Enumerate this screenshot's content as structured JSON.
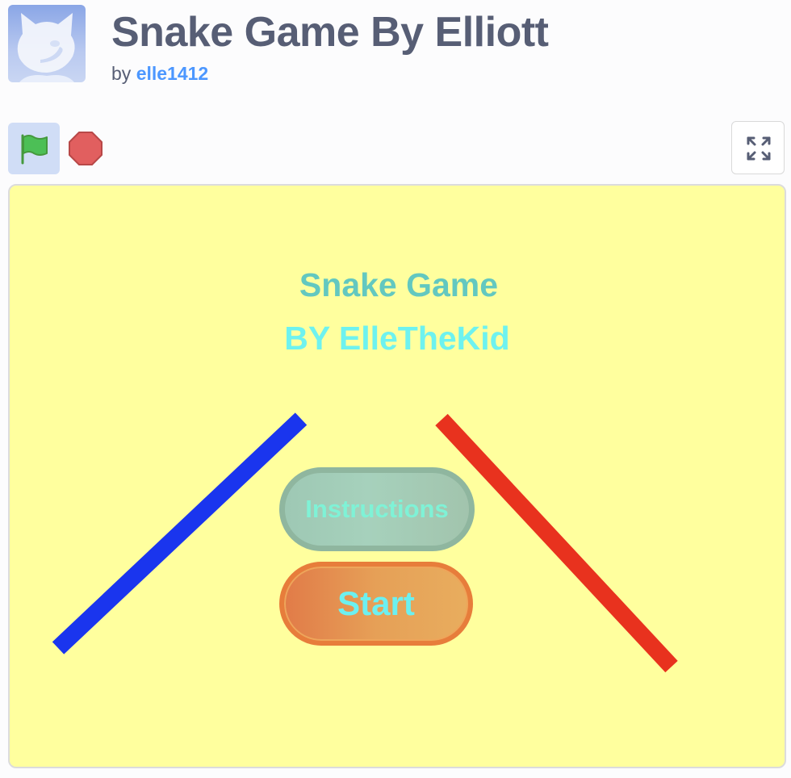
{
  "project": {
    "title": "Snake Game By Elliott",
    "by_prefix": "by",
    "author": "elle1412"
  },
  "controls": {
    "green_flag_icon": "green-flag-icon",
    "stop_icon": "stop-icon",
    "fullscreen_icon": "fullscreen-icon"
  },
  "stage": {
    "background_color": "#ffff9e",
    "title": "Snake Game",
    "subtitle": "BY ElleTheKid",
    "buttons": {
      "instructions_label": "Instructions",
      "start_label": "Start"
    },
    "colors": {
      "left_line": "#1a35ee",
      "right_line": "#e8321e"
    }
  }
}
